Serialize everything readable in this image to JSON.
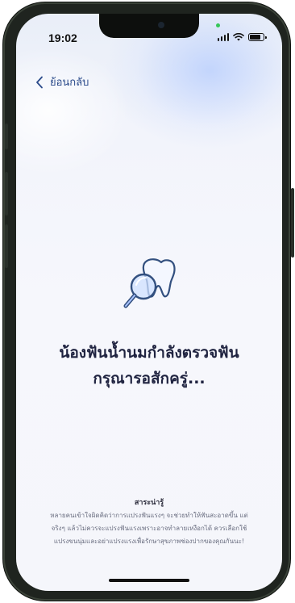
{
  "status_bar": {
    "time": "19:02"
  },
  "nav": {
    "back_label": "ย้อนกลับ"
  },
  "main": {
    "heading_line1": "น้องฟันน้ำนมกำลังตรวจฟัน",
    "heading_line2": "กรุณารอสักครู่..."
  },
  "tip": {
    "title": "สาระน่ารู้",
    "line1": "หลายคนเข้าใจผิดคิดว่าการแปรงฟันแรงๆ จะช่วยทำให้ฟันสะอาดขึ้น แต่",
    "line2": "จริงๆ แล้วไม่ควรจะแปรงฟันแรงเพราะอาจทำลายเหงือกได้ ควรเลือกใช้",
    "line3": "แปรงขนนุ่มและอย่าแปรงแรงเพื่อรักษาสุขภาพช่องปากของคุณกันนะ!"
  },
  "colors": {
    "accent": "#2a4a8a",
    "heading": "#1f2340",
    "illustration_stroke": "#33507f"
  },
  "icons": {
    "back": "chevron-left-icon",
    "illustration": "tooth-magnifier-icon",
    "wifi": "wifi-icon",
    "signal": "signal-icon",
    "battery": "battery-icon"
  }
}
